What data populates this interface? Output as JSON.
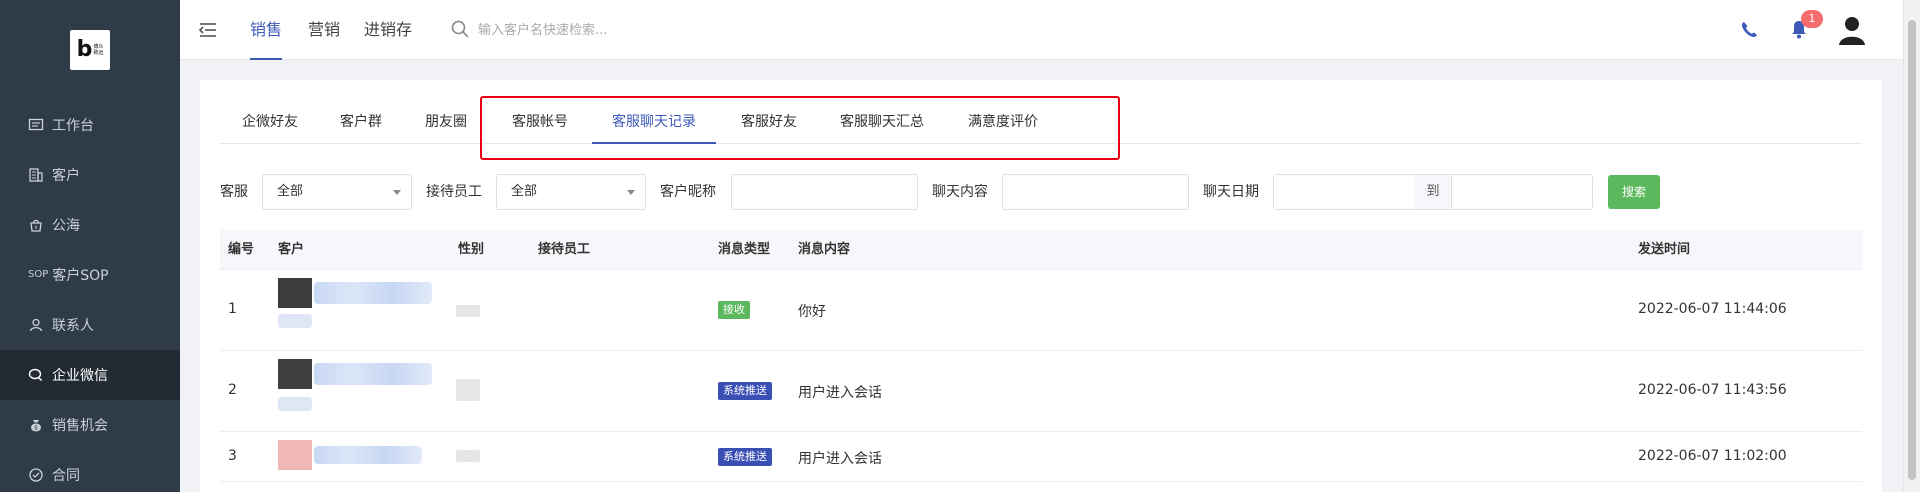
{
  "logo": {
    "letter": "b",
    "text": "博众\n致远"
  },
  "sidebar": {
    "items": [
      {
        "label": "工作台",
        "icon": "dashboard-icon"
      },
      {
        "label": "客户",
        "icon": "customer-building-icon"
      },
      {
        "label": "公海",
        "icon": "public-pool-bag-icon"
      },
      {
        "label": "客户SOP",
        "icon": "sop-icon"
      },
      {
        "label": "联系人",
        "icon": "contact-person-icon"
      },
      {
        "label": "企业微信",
        "icon": "wechat-work-icon",
        "active": true
      },
      {
        "label": "销售机会",
        "icon": "money-bag-icon"
      },
      {
        "label": "合同",
        "icon": "contract-icon"
      }
    ]
  },
  "topbar": {
    "tabs": [
      "销售",
      "营销",
      "进销存"
    ],
    "active_tab": "销售",
    "search_placeholder": "输入客户名快速检索...",
    "notification_count": "1"
  },
  "subtabs": {
    "items": [
      "企微好友",
      "客户群",
      "朋友圈",
      "客服帐号",
      "客服聊天记录",
      "客服好友",
      "客服聊天汇总",
      "满意度评价"
    ],
    "active": "客服聊天记录"
  },
  "filters": {
    "service_label": "客服",
    "service_value": "全部",
    "staff_label": "接待员工",
    "staff_value": "全部",
    "nickname_label": "客户昵称",
    "content_label": "聊天内容",
    "date_label": "聊天日期",
    "date_to": "到",
    "search_button": "搜索"
  },
  "table": {
    "headers": [
      "编号",
      "客户",
      "性别",
      "接待员工",
      "消息类型",
      "消息内容",
      "发送时间"
    ],
    "rows": [
      {
        "no": "1",
        "type": "接收",
        "type_kind": "recv",
        "content": "你好",
        "time": "2022-06-07 11:44:06"
      },
      {
        "no": "2",
        "type": "系统推送",
        "type_kind": "sys",
        "content": "用户进入会话",
        "time": "2022-06-07 11:43:56"
      },
      {
        "no": "3",
        "type": "系统推送",
        "type_kind": "sys",
        "content": "用户进入会话",
        "time": "2022-06-07 11:02:00"
      }
    ]
  },
  "colors": {
    "sidebar_bg": "#2f3b47",
    "accent": "#3d5ab8",
    "highlight": "#e60012",
    "success": "#5cb85c",
    "badge": "#f56c6c"
  }
}
